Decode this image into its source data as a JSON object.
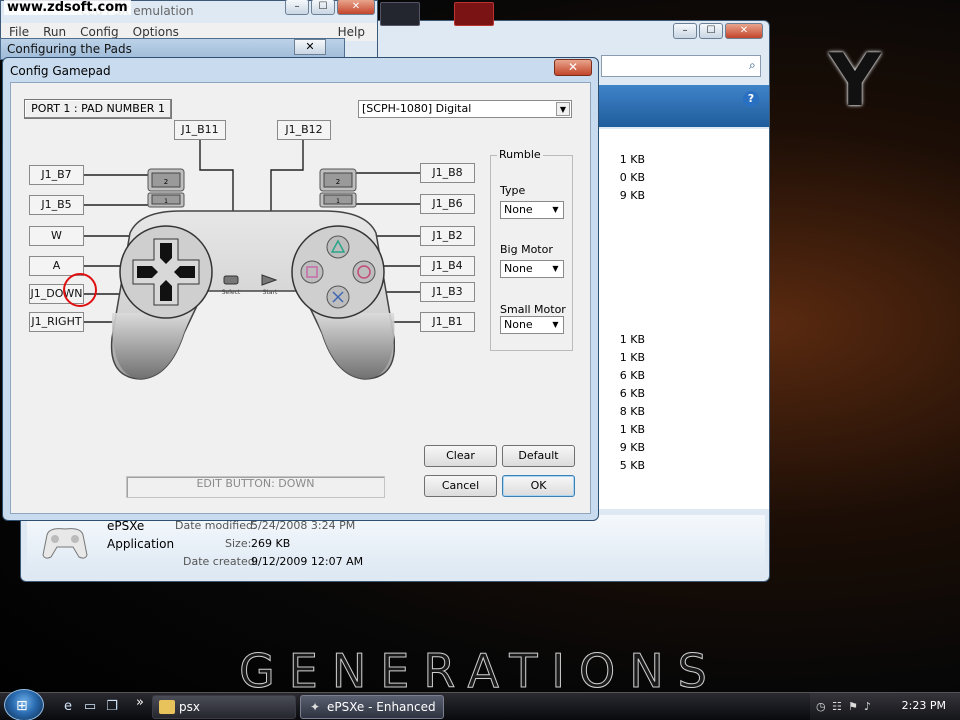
{
  "watermark": "www.zdsoft.com",
  "desktop": {
    "logo_letter": "Y",
    "title": "GENERATIONS"
  },
  "epsxe_window": {
    "title": "ePSXe - Enhanced PSX emulator",
    "title_visible": "ced PSX emulation",
    "menu": [
      "File",
      "Run",
      "Config",
      "Options"
    ],
    "help": "Help"
  },
  "pads_window": {
    "title": "Configuring the Pads",
    "close": "✕"
  },
  "explorer": {
    "sizes": [
      "1 KB",
      "0 KB",
      "9 KB",
      "",
      "",
      "",
      "",
      "",
      "",
      "",
      "1 KB",
      "1 KB",
      "6 KB",
      "6 KB",
      "8 KB",
      "1 KB",
      "9 KB",
      "5 KB"
    ],
    "details": {
      "name": "ePSXe",
      "type": "Application",
      "modified_label": "Date modified:",
      "modified_value": "5/24/2008 3:24 PM",
      "size_label": "Size:",
      "size_value": "269 KB",
      "created_label": "Date created:",
      "created_value": "9/12/2009 12:07 AM"
    }
  },
  "dialog": {
    "title": "Config Gamepad",
    "close": "✕",
    "port": "PORT 1 : PAD NUMBER 1",
    "pad_type": "[SCPH-1080] Digital",
    "left_keys": [
      "J1_B7",
      "J1_B5",
      "W",
      "A",
      "J1_DOWN",
      "J1_RIGHT"
    ],
    "right_keys": [
      "J1_B8",
      "J1_B6",
      "J1_B2",
      "J1_B4",
      "J1_B3",
      "J1_B1"
    ],
    "top_keys": [
      "J1_B11",
      "J1_B12"
    ],
    "gamepad_labels": {
      "select": "Select",
      "start": "Start",
      "l2": "2",
      "l1": "1",
      "r2": "2",
      "r1": "1"
    },
    "rumble": {
      "legend": "Rumble",
      "type_label": "Type",
      "type_value": "None",
      "big_label": "Big Motor",
      "big_value": "None",
      "small_label": "Small Motor",
      "small_value": "None"
    },
    "edit_status": "EDIT BUTTON: DOWN",
    "buttons": {
      "clear": "Clear",
      "default": "Default",
      "cancel": "Cancel",
      "ok": "OK"
    }
  },
  "taskbar": {
    "items": [
      {
        "label": "psx",
        "icon": "folder-icon"
      },
      {
        "label": "ePSXe - Enhanced ...",
        "icon": "gamepad-icon"
      }
    ],
    "chevron": "»",
    "clock": "2:23 PM"
  },
  "colors": {
    "accent": "#3c7fb1",
    "close_red": "#c2452a",
    "cursor_ring": "#e01010"
  }
}
